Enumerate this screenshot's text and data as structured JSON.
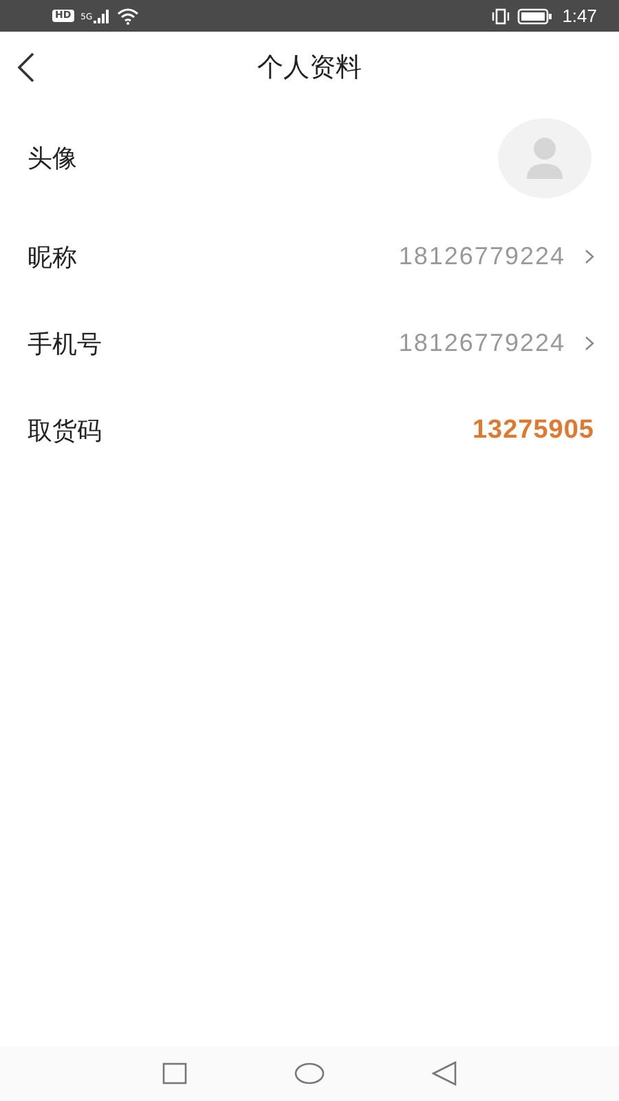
{
  "status_bar": {
    "badge": "HD",
    "network": "5G",
    "time": "1:47"
  },
  "header": {
    "title": "个人资料"
  },
  "rows": [
    {
      "kind": "avatar",
      "label": "头像"
    },
    {
      "kind": "link",
      "label": "昵称",
      "value": "18126779224"
    },
    {
      "kind": "link",
      "label": "手机号",
      "value": "18126779224"
    },
    {
      "kind": "highlight",
      "label": "取货码",
      "value": "13275905"
    }
  ]
}
